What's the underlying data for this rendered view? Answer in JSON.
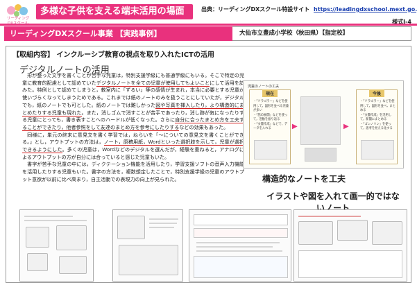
{
  "header": {
    "logo_text": "リーディング\nDXスクール",
    "title": "多様な子供を支える端末活用の場面",
    "source_label": "出典：リーディングDXスクール特設サイト",
    "source_url": "https://leadingdxschool.mext.go.jp/",
    "form_no": "様式Ⅰ-4"
  },
  "project_bar": {
    "title": "リーディングDXスクール事業 【実践事例】",
    "school": "大仙市立豊成小学校（秋田県）【指定校】"
  },
  "main": {
    "activity": "【取組内容】 インクルーシブ教育の視点を取り入れたICTの活用",
    "section_heading": "デジタルノートの活用",
    "paragraphs": [
      {
        "segments": [
          {
            "text": "形が整った文字を書くことが苦手な児童は，特別支援学級にも普通学級にもいる。そこで特定の児童に教育的配慮として認めていた",
            "hl": false
          },
          {
            "text": "デジタルノートを全ての児童が使用してもよいこと",
            "hl": true
          },
          {
            "text": "にして活用を試みた。特例として認めてしまうと，教室内に「ずるい」等の感情が生まれ，本当に必要とする児童が使いづらくなってしまうためである。これまでは紙のノートのみを扱うことにしていたが，デジタルでも，紙のノートでも可とした。紙のノートでは難しかった",
            "hl": false
          },
          {
            "text": "図や写真を挿入したり，より構造的にまとめたりする児童も現れた",
            "hl": true
          },
          {
            "text": "。また，消しゴムで消すことが苦手であったり，消し跡が気になったりする児童にとっても，書き表すことへのハードルが低くなった。さらに",
            "hl": false
          },
          {
            "text": "自分に合ったまとめ方を工夫することができたり，他者参照をして友達のまとめ方を参考にしたりする",
            "hl": true
          },
          {
            "text": "などの効果もあった。",
            "hl": false
          }
        ]
      },
      {
        "segments": [
          {
            "text": "同様に，単元の終末に意見文を書く学習では，ねらいを「～についての意見文を書くことができる。」とし，アウトプットの方法は，",
            "hl": false
          },
          {
            "text": "ノート，原稿用紙，Wordといった選択肢を示して，児童が選択できるようにした",
            "hl": true
          },
          {
            "text": "。多くの児童は，Wordなどのデジタルを選んだが，経験を重ねると，アナログによるアウトプットの方が自分には合っていると感じた児童もいた。",
            "hl": false
          }
        ]
      },
      {
        "segments": [
          {
            "text": "書字が苦手な児童の中には，ディクテーション機能を活用したり，学習支援ソフトの音声入力機能を活用したりする児童もいた。書字の方法を，複数想定したことで，特別支援学級の児童のアウトプット意欲が以前に比べ高まり，自主活動での表現力の向上が見られた。",
            "hl": false
          }
        ]
      }
    ]
  },
  "diagram": {
    "title": "児童のノートの工夫",
    "before_label": "現在",
    "after_label": "今後",
    "before_items": "・「ドラゴラー」などを使用して，図形を並べる児童が多い\n・「話の展開」などを使って，活動を振り返る\n・「文書作成」などで，データを入れる",
    "after_items": "・「ドラゴラー」などを使用して，図形を並べ，まとめる\n・「文書作成」を活用して，新聞にまとめる\n・「ゴンノリン」を使って，思考を見える化する"
  },
  "captions": {
    "caption1": "構造的なノートを工夫",
    "caption2": "イラストや図を入れて画一的ではないノート"
  },
  "colors": {
    "accent": "#e9317d",
    "underline": "#d42020",
    "url": "#1a3fb0"
  }
}
